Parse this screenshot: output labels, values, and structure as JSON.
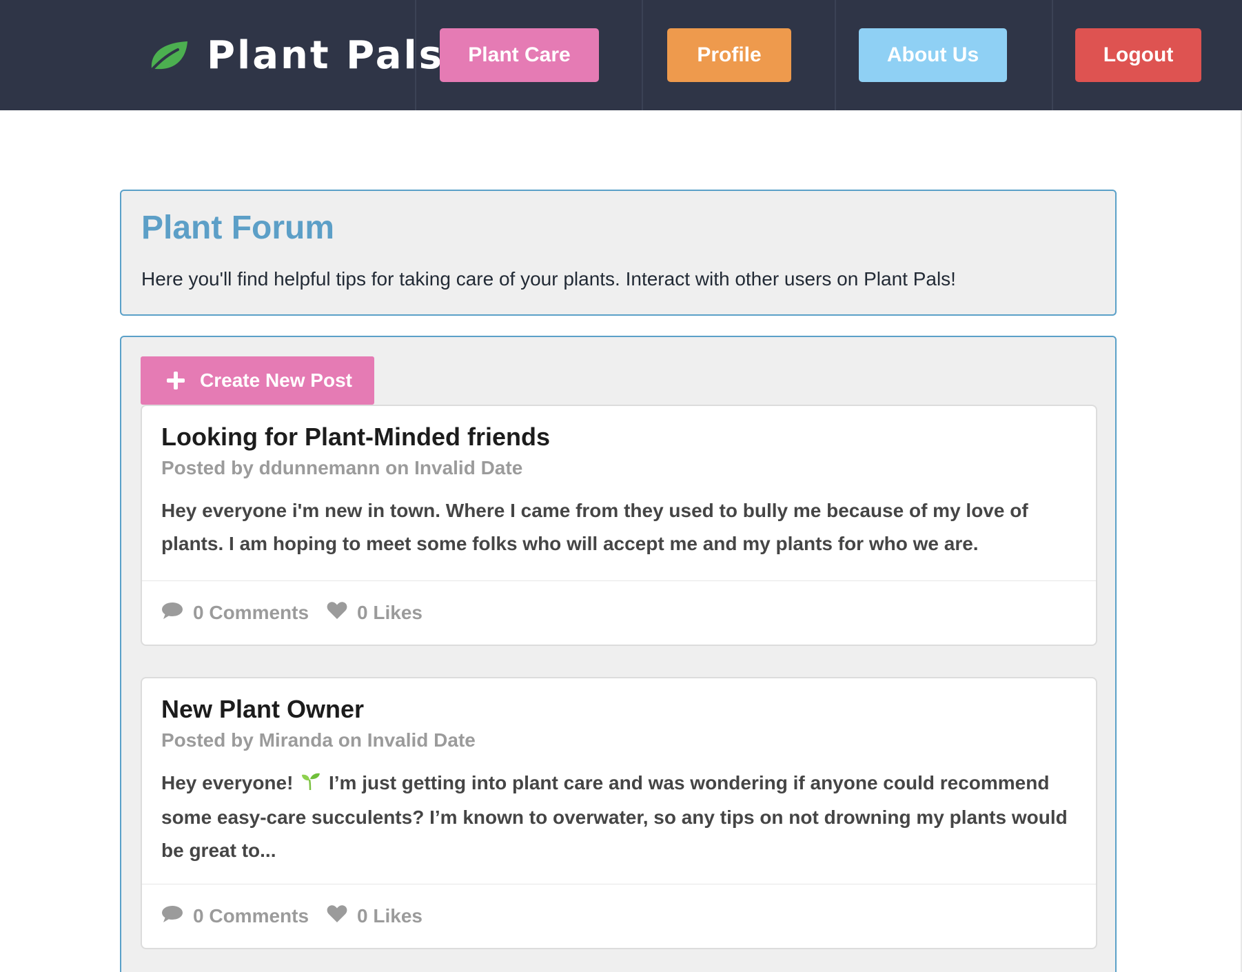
{
  "app": {
    "brand": "Plant Pals",
    "colors": {
      "navbar": "#2f3547",
      "plant_care": "#e57bb4",
      "profile": "#ee9a4d",
      "about_us": "#8fd0f4",
      "logout": "#de5351",
      "accent": "#5c9fc7"
    }
  },
  "nav": {
    "plant_care": "Plant Care",
    "profile": "Profile",
    "about_us": "About Us",
    "logout": "Logout"
  },
  "hero": {
    "title": "Plant Forum",
    "subtitle": "Here you'll find helpful tips for taking care of your plants. Interact with other users on Plant Pals!"
  },
  "feed": {
    "create_label": "Create New Post",
    "posts": [
      {
        "title": "Looking for Plant-Minded friends",
        "meta": "Posted by ddunnemann on Invalid Date",
        "body": "Hey everyone i'm new in town. Where I came from they used to bully me because of my love of plants. I am hoping to meet some folks who will accept me and my plants for who we are.",
        "comments": "0 Comments",
        "likes": "0 Likes"
      },
      {
        "title": "New Plant Owner",
        "meta": "Posted by Miranda on Invalid Date",
        "body_before": "Hey everyone!",
        "body_after": "I’m just getting into plant care and was wondering if anyone could recommend some easy-care succulents? I’m known to overwater, so any tips on not drowning my plants would be great to...",
        "comments": "0 Comments",
        "likes": "0 Likes"
      }
    ]
  },
  "icons": [
    "leaf-icon",
    "plus-icon",
    "comment-icon",
    "heart-icon",
    "sprout-emoji-icon"
  ]
}
